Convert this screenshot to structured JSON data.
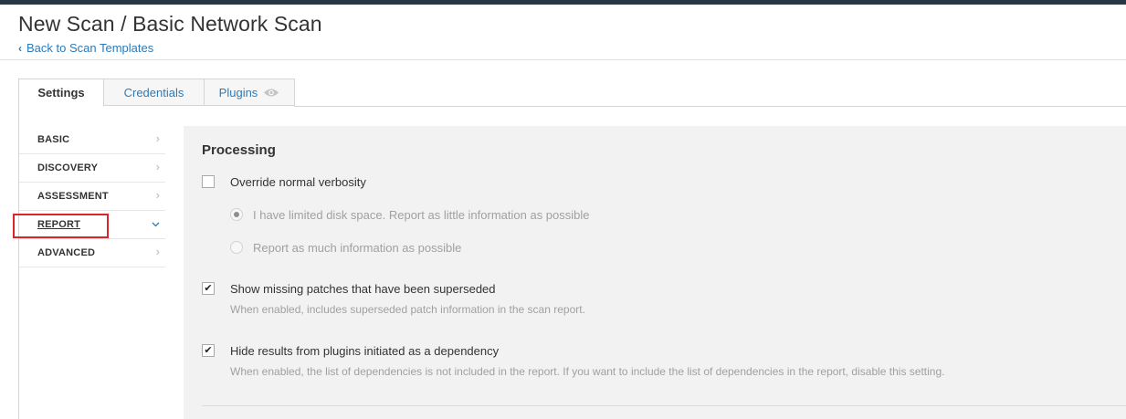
{
  "header": {
    "title": "New Scan / Basic Network Scan",
    "back_link": "Back to Scan Templates"
  },
  "tabs": [
    {
      "label": "Settings",
      "active": true
    },
    {
      "label": "Credentials",
      "active": false
    },
    {
      "label": "Plugins",
      "active": false,
      "icon": "eye-icon"
    }
  ],
  "sidebar": {
    "items": [
      {
        "label": "BASIC",
        "icon": "chevron-right-icon"
      },
      {
        "label": "DISCOVERY",
        "icon": "chevron-right-icon"
      },
      {
        "label": "ASSESSMENT",
        "icon": "chevron-right-icon"
      },
      {
        "label": "REPORT",
        "icon": "chevron-down-icon",
        "active": true,
        "highlighted": true
      },
      {
        "label": "ADVANCED",
        "icon": "chevron-right-icon"
      }
    ]
  },
  "processing": {
    "title": "Processing",
    "override": {
      "label": "Override normal verbosity",
      "checked": false
    },
    "radio_options": [
      {
        "label": "I have limited disk space. Report as little information as possible",
        "selected": true,
        "disabled": true
      },
      {
        "label": "Report as much information as possible",
        "selected": false,
        "disabled": true
      }
    ],
    "superseded": {
      "label": "Show missing patches that have been superseded",
      "help": "When enabled, includes superseded patch information in the scan report.",
      "checked": true
    },
    "hide_dependency": {
      "label": "Hide results from plugins initiated as a dependency",
      "help": "When enabled, the list of dependencies is not included in the report. If you want to include the list of dependencies in the report, disable this setting.",
      "checked": true
    }
  },
  "colors": {
    "link": "#2b7bb9",
    "topbar": "#263746",
    "panel_bg": "#f2f2f2",
    "highlight": "#d9262c"
  }
}
